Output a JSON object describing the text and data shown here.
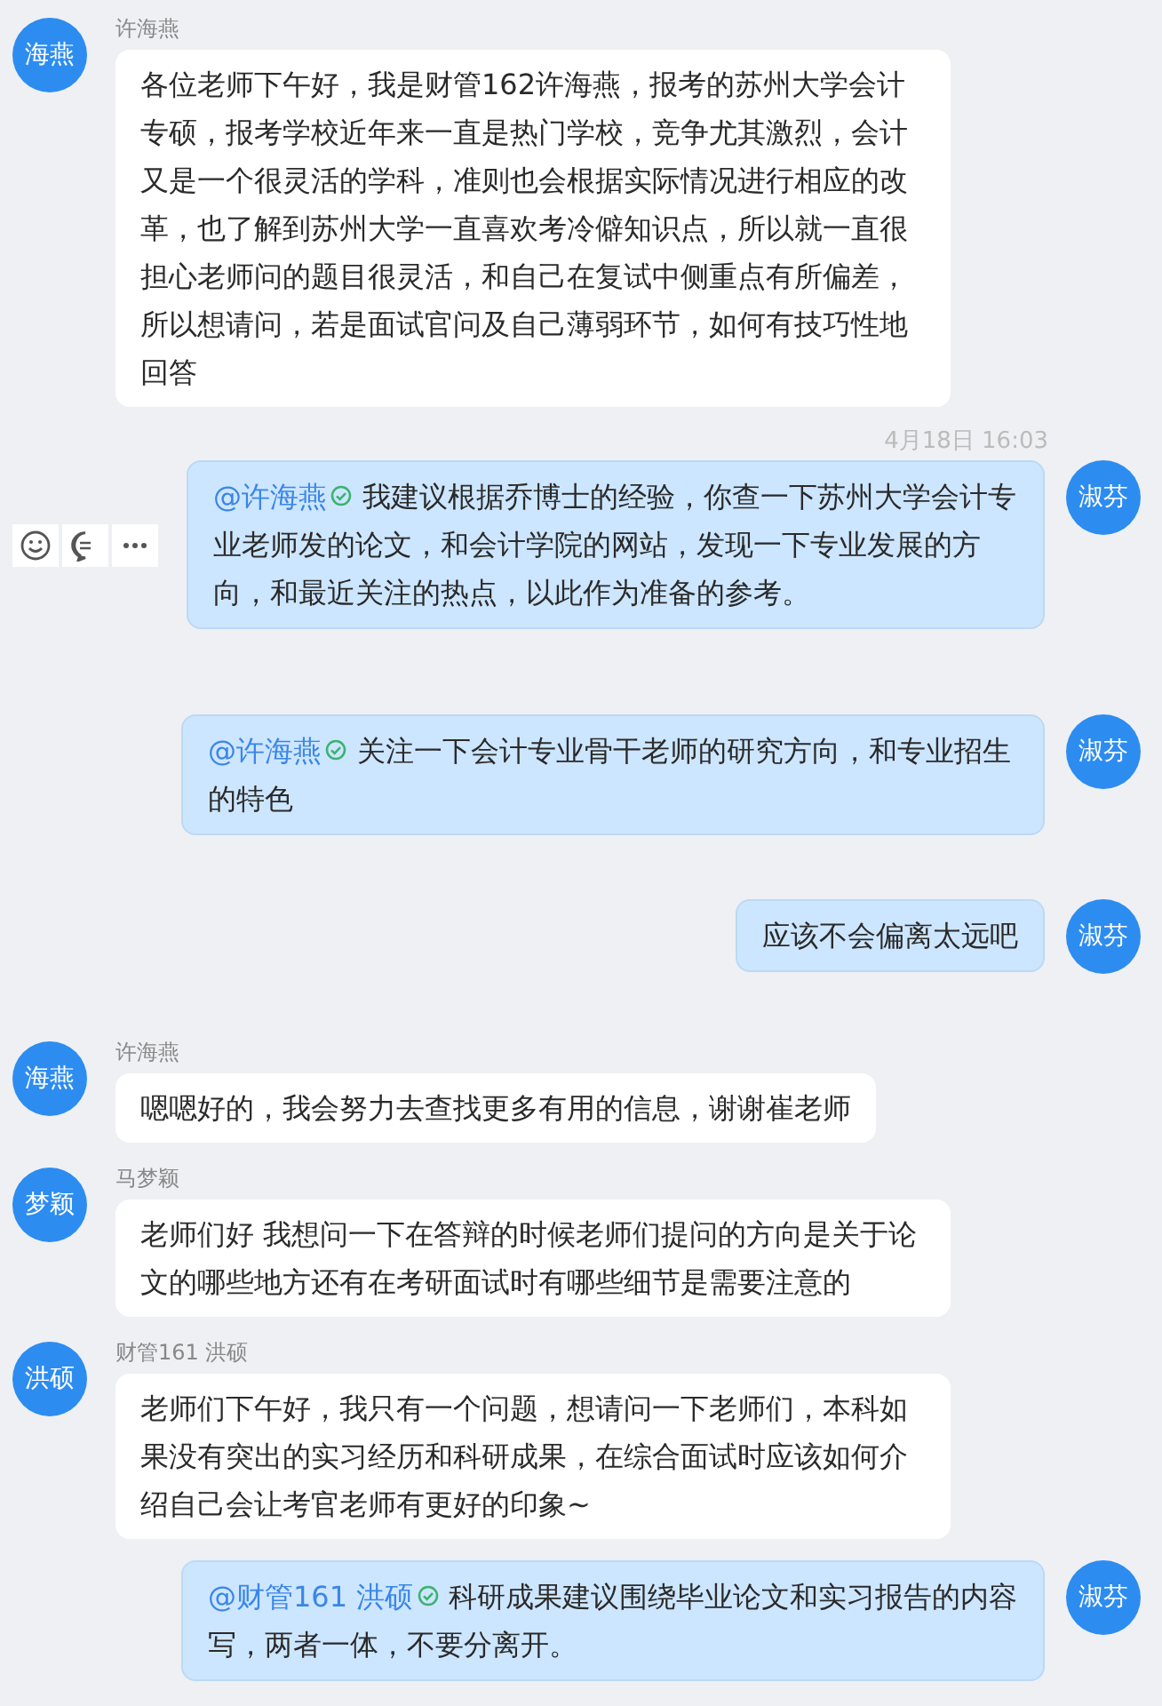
{
  "messages": [
    {
      "kind": "incoming",
      "avatar": "海燕",
      "sender": "许海燕",
      "text": "各位老师下午好，我是财管162许海燕，报考的苏州大学会计专硕，报考学校近年来一直是热门学校，竞争尤其激烈，会计又是一个很灵活的学科，准则也会根据实际情况进行相应的改革，也了解到苏州大学一直喜欢考冷僻知识点，所以就一直很担心老师问的题目很灵活，和自己在复试中侧重点有所偏差，所以想请问，若是面试官问及自己薄弱环节，如何有技巧性地回答"
    },
    {
      "kind": "timestamp",
      "text": "4月18日 16:03"
    },
    {
      "kind": "outgoing",
      "avatar": "淑芬",
      "mention": "@许海燕",
      "text": "我建议根据乔博士的经验，你查一下苏州大学会计专业老师发的论文，和会计学院的网站，发现一下专业发展的方向，和最近关注的热点，以此作为准备的参考。",
      "hovered": true
    },
    {
      "kind": "outgoing",
      "avatar": "淑芬",
      "mention": "@许海燕",
      "text": "关注一下会计专业骨干老师的研究方向，和专业招生的特色",
      "hovered": false
    },
    {
      "kind": "outgoing",
      "avatar": "淑芬",
      "text": "应该不会偏离太远吧",
      "hovered": false
    },
    {
      "kind": "incoming",
      "avatar": "海燕",
      "sender": "许海燕",
      "text": "嗯嗯好的，我会努力去查找更多有用的信息，谢谢崔老师"
    },
    {
      "kind": "incoming",
      "avatar": "梦颖",
      "sender": "马梦颖",
      "text": "老师们好 我想问一下在答辩的时候老师们提问的方向是关于论文的哪些地方还有在考研面试时有哪些细节是需要注意的"
    },
    {
      "kind": "incoming",
      "avatar": "洪硕",
      "sender": "财管161 洪硕",
      "text": "老师们下午好，我只有一个问题，想请问一下老师们，本科如果没有突出的实习经历和科研成果，在综合面试时应该如何介绍自己会让考官老师有更好的印象~"
    },
    {
      "kind": "outgoing",
      "avatar": "淑芬",
      "mention": "@财管161 洪硕",
      "text": "科研成果建议围绕毕业论文和实习报告的内容写，两者一体，不要分离开。",
      "hovered": false
    }
  ]
}
